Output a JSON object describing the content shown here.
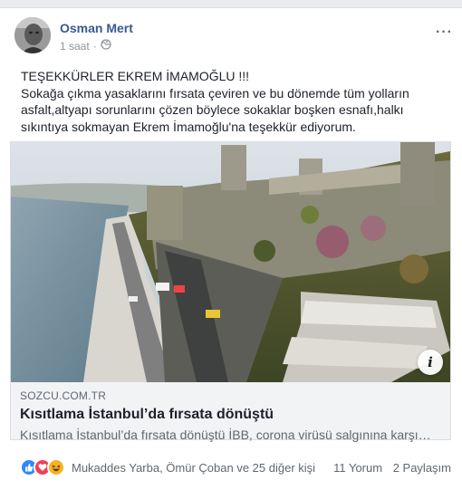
{
  "post": {
    "author": "Osman Mert",
    "time": "1 saat",
    "privacy_icon": "globe-icon",
    "more_icon": "more-options-icon",
    "text_lines": [
      "TEŞEKKÜRLER EKREM İMAMOĞLU !!!",
      "Sokağa çıkma yasaklarını fırsata çeviren ve bu dönemde tüm yolların",
      "asfalt,altyapı sorunlarını çözen böylece sokaklar boşken esnafı,halkı",
      "sıkıntıya sokmayan Ekrem İmamoğlu'na teşekkür ediyorum."
    ]
  },
  "link": {
    "domain": "SOZCU.COM.TR",
    "title": "Kısıtlama İstanbul’da fırsata dönüştü",
    "description": "Kısıtlama İstanbul’da fırsata dönüştü İBB, corona virüsü salgınına karşı…",
    "info_icon": "info-icon"
  },
  "footer": {
    "reaction_icons": [
      "like-icon",
      "love-icon",
      "haha-icon"
    ],
    "reactors": "Mukaddes Yarba, Ömür Çoban ve 25 diğer kişi",
    "comments": "11 Yorum",
    "shares": "2 Paylaşım"
  },
  "colors": {
    "author": "#385898",
    "like": "#2d88ff",
    "love": "#f33e58",
    "haha": "#f7b125"
  }
}
